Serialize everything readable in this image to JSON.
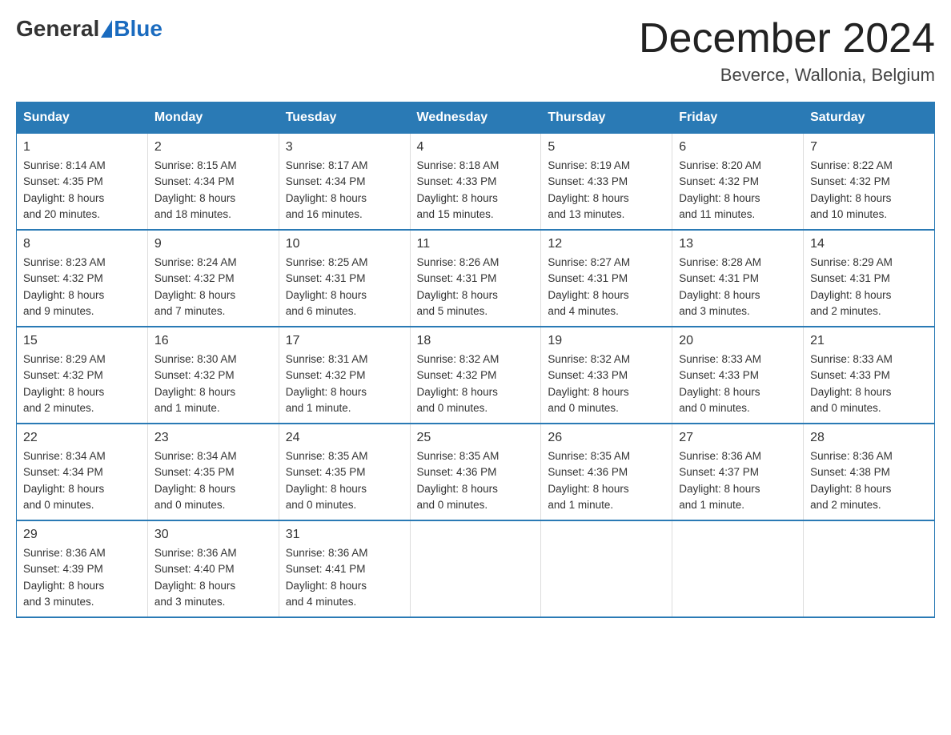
{
  "header": {
    "logo": {
      "general": "General",
      "blue": "Blue"
    },
    "title": "December 2024",
    "location": "Beverce, Wallonia, Belgium"
  },
  "days_of_week": [
    "Sunday",
    "Monday",
    "Tuesday",
    "Wednesday",
    "Thursday",
    "Friday",
    "Saturday"
  ],
  "weeks": [
    [
      {
        "day": "1",
        "sunrise": "8:14 AM",
        "sunset": "4:35 PM",
        "daylight": "8 hours and 20 minutes."
      },
      {
        "day": "2",
        "sunrise": "8:15 AM",
        "sunset": "4:34 PM",
        "daylight": "8 hours and 18 minutes."
      },
      {
        "day": "3",
        "sunrise": "8:17 AM",
        "sunset": "4:34 PM",
        "daylight": "8 hours and 16 minutes."
      },
      {
        "day": "4",
        "sunrise": "8:18 AM",
        "sunset": "4:33 PM",
        "daylight": "8 hours and 15 minutes."
      },
      {
        "day": "5",
        "sunrise": "8:19 AM",
        "sunset": "4:33 PM",
        "daylight": "8 hours and 13 minutes."
      },
      {
        "day": "6",
        "sunrise": "8:20 AM",
        "sunset": "4:32 PM",
        "daylight": "8 hours and 11 minutes."
      },
      {
        "day": "7",
        "sunrise": "8:22 AM",
        "sunset": "4:32 PM",
        "daylight": "8 hours and 10 minutes."
      }
    ],
    [
      {
        "day": "8",
        "sunrise": "8:23 AM",
        "sunset": "4:32 PM",
        "daylight": "8 hours and 9 minutes."
      },
      {
        "day": "9",
        "sunrise": "8:24 AM",
        "sunset": "4:32 PM",
        "daylight": "8 hours and 7 minutes."
      },
      {
        "day": "10",
        "sunrise": "8:25 AM",
        "sunset": "4:31 PM",
        "daylight": "8 hours and 6 minutes."
      },
      {
        "day": "11",
        "sunrise": "8:26 AM",
        "sunset": "4:31 PM",
        "daylight": "8 hours and 5 minutes."
      },
      {
        "day": "12",
        "sunrise": "8:27 AM",
        "sunset": "4:31 PM",
        "daylight": "8 hours and 4 minutes."
      },
      {
        "day": "13",
        "sunrise": "8:28 AM",
        "sunset": "4:31 PM",
        "daylight": "8 hours and 3 minutes."
      },
      {
        "day": "14",
        "sunrise": "8:29 AM",
        "sunset": "4:31 PM",
        "daylight": "8 hours and 2 minutes."
      }
    ],
    [
      {
        "day": "15",
        "sunrise": "8:29 AM",
        "sunset": "4:32 PM",
        "daylight": "8 hours and 2 minutes."
      },
      {
        "day": "16",
        "sunrise": "8:30 AM",
        "sunset": "4:32 PM",
        "daylight": "8 hours and 1 minute."
      },
      {
        "day": "17",
        "sunrise": "8:31 AM",
        "sunset": "4:32 PM",
        "daylight": "8 hours and 1 minute."
      },
      {
        "day": "18",
        "sunrise": "8:32 AM",
        "sunset": "4:32 PM",
        "daylight": "8 hours and 0 minutes."
      },
      {
        "day": "19",
        "sunrise": "8:32 AM",
        "sunset": "4:33 PM",
        "daylight": "8 hours and 0 minutes."
      },
      {
        "day": "20",
        "sunrise": "8:33 AM",
        "sunset": "4:33 PM",
        "daylight": "8 hours and 0 minutes."
      },
      {
        "day": "21",
        "sunrise": "8:33 AM",
        "sunset": "4:33 PM",
        "daylight": "8 hours and 0 minutes."
      }
    ],
    [
      {
        "day": "22",
        "sunrise": "8:34 AM",
        "sunset": "4:34 PM",
        "daylight": "8 hours and 0 minutes."
      },
      {
        "day": "23",
        "sunrise": "8:34 AM",
        "sunset": "4:35 PM",
        "daylight": "8 hours and 0 minutes."
      },
      {
        "day": "24",
        "sunrise": "8:35 AM",
        "sunset": "4:35 PM",
        "daylight": "8 hours and 0 minutes."
      },
      {
        "day": "25",
        "sunrise": "8:35 AM",
        "sunset": "4:36 PM",
        "daylight": "8 hours and 0 minutes."
      },
      {
        "day": "26",
        "sunrise": "8:35 AM",
        "sunset": "4:36 PM",
        "daylight": "8 hours and 1 minute."
      },
      {
        "day": "27",
        "sunrise": "8:36 AM",
        "sunset": "4:37 PM",
        "daylight": "8 hours and 1 minute."
      },
      {
        "day": "28",
        "sunrise": "8:36 AM",
        "sunset": "4:38 PM",
        "daylight": "8 hours and 2 minutes."
      }
    ],
    [
      {
        "day": "29",
        "sunrise": "8:36 AM",
        "sunset": "4:39 PM",
        "daylight": "8 hours and 3 minutes."
      },
      {
        "day": "30",
        "sunrise": "8:36 AM",
        "sunset": "4:40 PM",
        "daylight": "8 hours and 3 minutes."
      },
      {
        "day": "31",
        "sunrise": "8:36 AM",
        "sunset": "4:41 PM",
        "daylight": "8 hours and 4 minutes."
      },
      null,
      null,
      null,
      null
    ]
  ],
  "labels": {
    "sunrise": "Sunrise:",
    "sunset": "Sunset:",
    "daylight": "Daylight:"
  }
}
